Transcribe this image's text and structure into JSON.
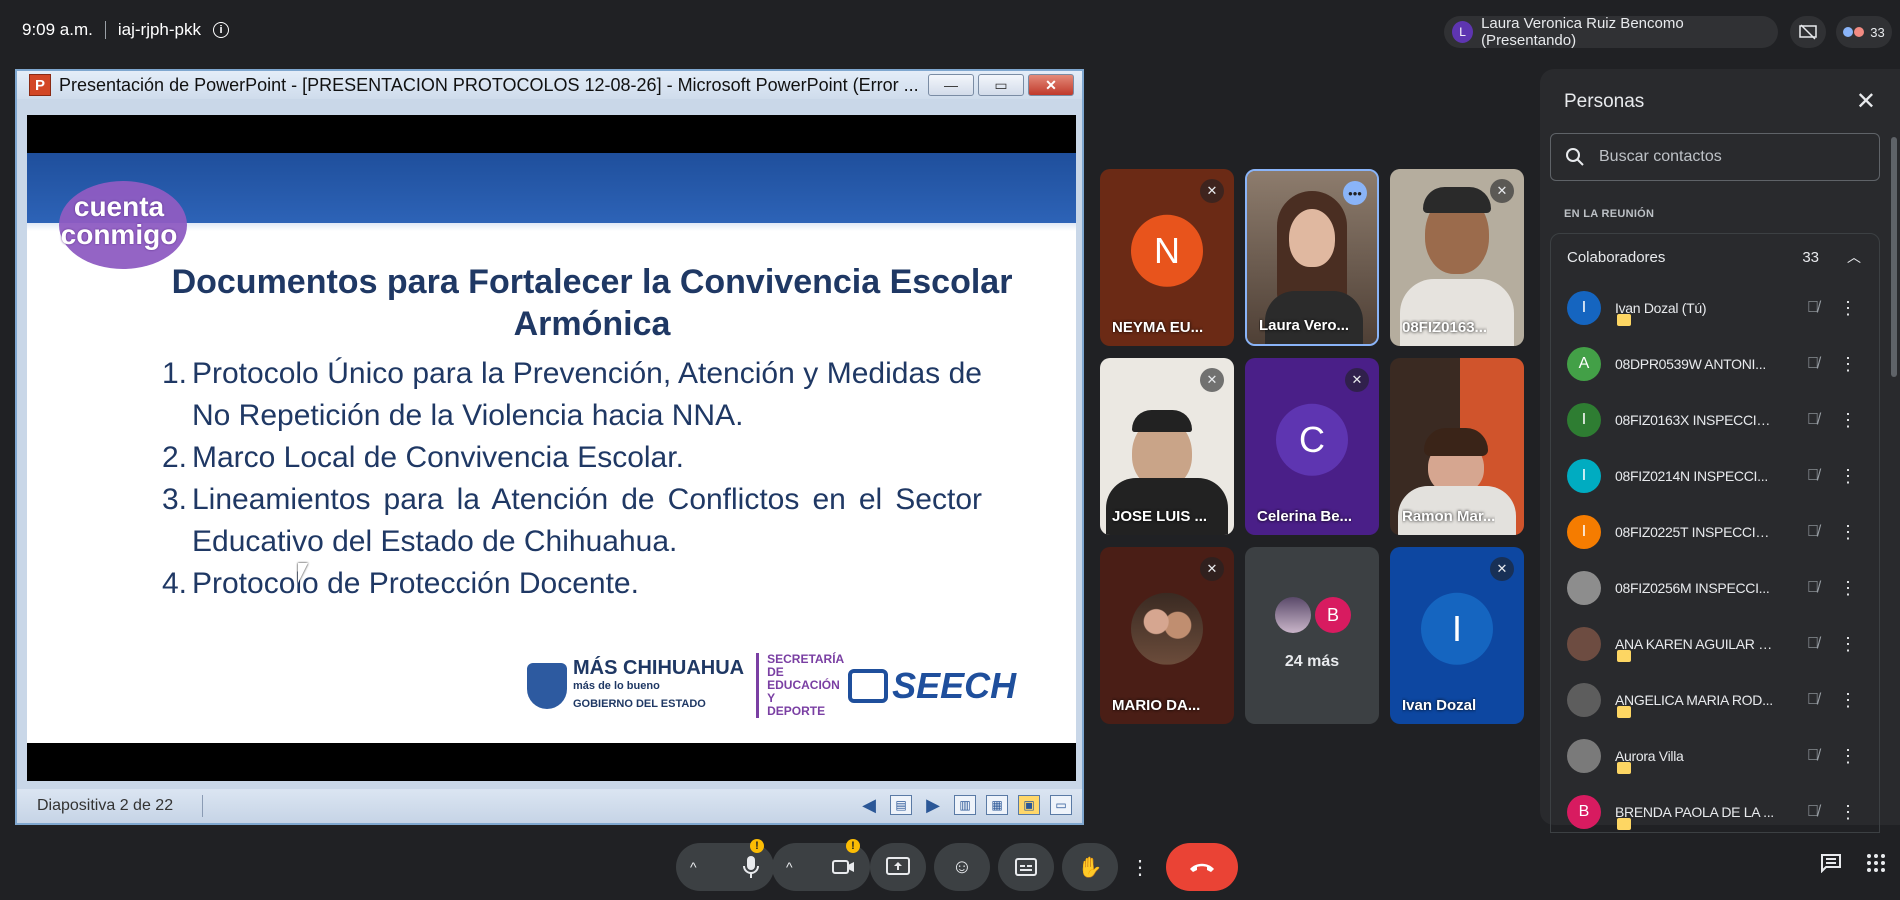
{
  "topbar": {
    "time": "9:09 a.m.",
    "meeting_code": "iaj-rjph-pkk",
    "presenter_initial": "L",
    "presenter_label": "Laura Veronica Ruiz Bencomo (Presentando)",
    "participant_count": "33"
  },
  "presentation": {
    "window_title": "Presentación de PowerPoint - [PRESENTACION PROTOCOLOS 12-08-26] - Microsoft PowerPoint (Error ...",
    "logo_text": "cuenta conmigo",
    "slide_title": "Documentos para Fortalecer la Convivencia Escolar Armónica",
    "items": [
      {
        "num": "1.",
        "text": "Protocolo Único para la Prevención, Atención y Medidas de No Repetición de la Violencia hacia NNA."
      },
      {
        "num": "2.",
        "text": "Marco Local de Convivencia Escolar."
      },
      {
        "num": "3.",
        "text": "Lineamientos para la Atención de Conflictos en el Sector Educativo del Estado de Chihuahua."
      },
      {
        "num": "4.",
        "text": "Protocolo de Protección Docente."
      }
    ],
    "footer_mas": "MÁS CHIHUAHUA",
    "footer_mas_sub": "más de lo bueno",
    "footer_gob": "GOBIERNO DEL ESTADO",
    "footer_sec": "SECRETARÍA DE EDUCACIÓN Y DEPORTE",
    "footer_seech": "SEECH",
    "slide_status": "Diapositiva 2 de 22"
  },
  "tiles": [
    {
      "name": "NEYMA EU...",
      "initial": "N",
      "color": "#e8541c"
    },
    {
      "name": "Laura Vero..."
    },
    {
      "name": "08FIZ0163..."
    },
    {
      "name": "JOSE LUIS ..."
    },
    {
      "name": "Celerina Be...",
      "initial": "C",
      "color": "#5e35b1"
    },
    {
      "name": "Ramon Mar..."
    },
    {
      "name": "MARIO DA..."
    },
    {
      "more_label": "24 más",
      "initial": "B"
    },
    {
      "name": "Ivan Dozal",
      "initial": "I",
      "color": "#1565c0"
    }
  ],
  "people_panel": {
    "title": "Personas",
    "search_placeholder": "Buscar contactos",
    "section_label": "EN LA REUNIÓN",
    "group_name": "Colaboradores",
    "group_count": "33",
    "people": [
      {
        "name": "Ivan Dozal (Tú)",
        "initial": "I",
        "color": "#1565c0",
        "badge": true
      },
      {
        "name": "08DPR0539W ANTONI...",
        "initial": "A",
        "color": "#43a047",
        "badge": false
      },
      {
        "name": "08FIZ0163X INSPECCIO...",
        "initial": "I",
        "color": "#2e7d32",
        "badge": false
      },
      {
        "name": "08FIZ0214N INSPECCI...",
        "initial": "I",
        "color": "#00acc1",
        "badge": false
      },
      {
        "name": "08FIZ0225T INSPECCIO...",
        "initial": "I",
        "color": "#f57c00",
        "badge": false
      },
      {
        "name": "08FIZ0256M INSPECCI...",
        "initial": "",
        "color": "#8d8d8d",
        "badge": false
      },
      {
        "name": "ANA KAREN AGUILAR R...",
        "initial": "",
        "color": "#6d4c41",
        "badge": true
      },
      {
        "name": "ANGELICA MARIA ROD...",
        "initial": "",
        "color": "#5d5d5d",
        "badge": true
      },
      {
        "name": "Aurora Villa",
        "initial": "",
        "color": "#7a7a7a",
        "badge": true
      },
      {
        "name": "BRENDA PAOLA DE LA ...",
        "initial": "B",
        "color": "#d81b60",
        "badge": true
      }
    ]
  },
  "colors": {
    "background": "#202124",
    "panel": "#292a2d",
    "hangup": "#ea4335",
    "warning": "#fbbc04"
  }
}
